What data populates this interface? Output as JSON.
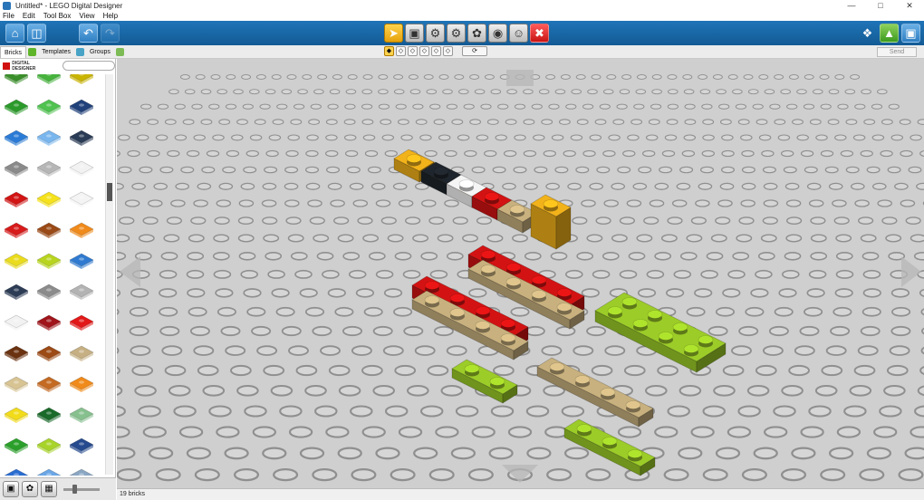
{
  "window": {
    "title": "Untitled* - LEGO Digital Designer",
    "controls": [
      "minimize",
      "maximize",
      "close"
    ]
  },
  "menu": {
    "items": [
      "File",
      "Edit",
      "Tool Box",
      "View",
      "Help"
    ]
  },
  "toolbar": {
    "left_icons": [
      "home-icon",
      "save-icon",
      "undo-icon",
      "redo-icon"
    ],
    "center_icons": [
      "select-arrow-icon",
      "clone-icon",
      "hinge-icon",
      "hinge-align-icon",
      "flex-icon",
      "paint-bucket-icon",
      "hide-icon",
      "delete-icon"
    ],
    "right_icons": [
      "build-mode-icon",
      "view-mode-icon",
      "building-guide-icon"
    ]
  },
  "subbar": {
    "tabs": [
      {
        "label": "Bricks",
        "active": true
      },
      {
        "label": "Templates",
        "active": false
      },
      {
        "label": "Groups",
        "active": false
      }
    ],
    "send_label": "Send"
  },
  "sidebar": {
    "logo_text": "DIGITAL DESIGNER",
    "search_placeholder": "",
    "palette_colors": [
      [
        "#3a8f2a",
        "#46b33c",
        "#c9b400"
      ],
      [
        "#2b9a2b",
        "#4fc24f",
        "#20407a"
      ],
      [
        "#2a7bd6",
        "#79b6ee",
        "#2a3b55"
      ],
      [
        "#8a8a8a",
        "#b6b6b6",
        "#f2f2f2"
      ],
      [
        "#d21414",
        "#f5e21c",
        "#f4f4f4"
      ],
      [
        "#d71a1a",
        "#9a4a16",
        "#f08a1a"
      ],
      [
        "#eadc1c",
        "#b8d41e",
        "#2f7ad0"
      ],
      [
        "#2c3c55",
        "#8b8b8b",
        "#b3b3b3"
      ],
      [
        "#f2f2f2",
        "#a0141a",
        "#e21818"
      ],
      [
        "#6a3210",
        "#9c4a16",
        "#c6b083"
      ],
      [
        "#d8c493",
        "#c46a22",
        "#f08a1a"
      ],
      [
        "#f2dc1a",
        "#1a6a2a",
        "#86c08e"
      ],
      [
        "#2aa02a",
        "#a8d42a",
        "#264a8e"
      ],
      [
        "#2a6cd0",
        "#6aa6e6",
        "#8aa6c2"
      ]
    ]
  },
  "bottom_left": {
    "icons": [
      "brick-palette-icon",
      "paint-palette-icon",
      "decoration-icon"
    ]
  },
  "status": {
    "text": "19 bricks"
  },
  "colors": {
    "toolbar_blue": "#1a69a8",
    "baseplate": "#cfcfcf",
    "red": "#d31313",
    "lime": "#9ccc28",
    "tan": "#c8b17e",
    "yellow": "#f2b21a",
    "black": "#1f252c",
    "white": "#f5f5f5"
  }
}
